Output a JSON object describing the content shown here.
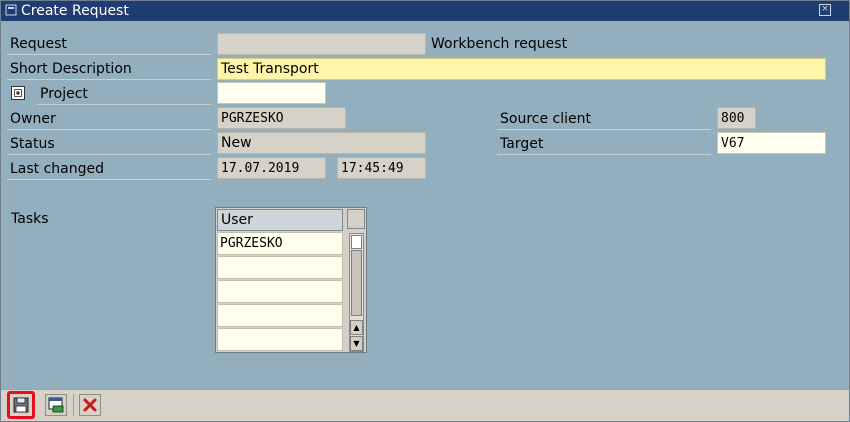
{
  "window": {
    "title": "Create Request"
  },
  "labels": {
    "request": "Request",
    "short_description": "Short Description",
    "project": "Project",
    "owner": "Owner",
    "status": "Status",
    "last_changed": "Last changed",
    "source_client": "Source client",
    "target": "Target",
    "tasks": "Tasks"
  },
  "fields": {
    "request_value": "",
    "request_type": "Workbench request",
    "short_description": "Test Transport",
    "project": "",
    "owner": "PGRZESKO",
    "status": "New",
    "last_changed_date": "17.07.2019",
    "last_changed_time": "17:45:49",
    "source_client": "800",
    "target": "V67"
  },
  "tasks_table": {
    "column": "User",
    "rows": [
      "PGRZESKO",
      "",
      "",
      "",
      ""
    ]
  },
  "toolbar": {
    "save": "save-icon",
    "copy": "copy-icon",
    "cancel": "cancel-icon"
  },
  "colors": {
    "title_bar": "#1f3d72",
    "background": "#93aebd",
    "required_field": "#fff5a8",
    "highlight": "#e2101e"
  }
}
